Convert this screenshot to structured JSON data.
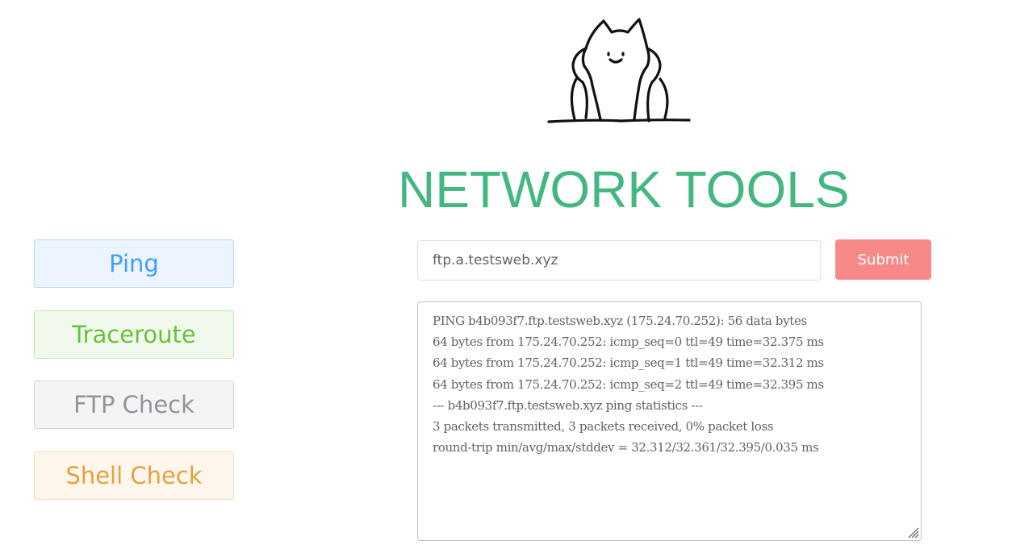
{
  "app": {
    "title": "NETWORK TOOLS",
    "logo_icon": "cat-icon",
    "title_color": "#42b77f"
  },
  "tools": [
    {
      "label": "Ping",
      "color": "#409eff"
    },
    {
      "label": "Traceroute",
      "color": "#67c23a"
    },
    {
      "label": "FTP Check",
      "color": "#909399"
    },
    {
      "label": "Shell Check",
      "color": "#e6a23c"
    }
  ],
  "form": {
    "host_value": "ftp.a.testsweb.xyz",
    "submit_label": "Submit",
    "submit_color": "#f78989"
  },
  "output": {
    "lines": [
      "PING b4b093f7.ftp.testsweb.xyz (175.24.70.252): 56 data bytes",
      "64 bytes from 175.24.70.252: icmp_seq=0 ttl=49 time=32.375 ms",
      "64 bytes from 175.24.70.252: icmp_seq=1 ttl=49 time=32.312 ms",
      "64 bytes from 175.24.70.252: icmp_seq=2 ttl=49 time=32.395 ms",
      "--- b4b093f7.ftp.testsweb.xyz ping statistics ---",
      "3 packets transmitted, 3 packets received, 0% packet loss",
      "round-trip min/avg/max/stddev = 32.312/32.361/32.395/0.035 ms"
    ]
  }
}
